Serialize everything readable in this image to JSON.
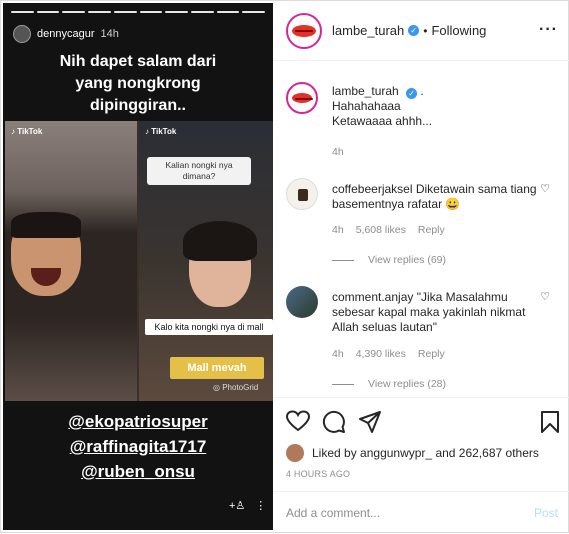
{
  "story": {
    "username": "dennycagur",
    "time": "14h",
    "caption_lines": [
      "Nih dapet salam dari",
      "yang nongkrong",
      "dipinggiran.."
    ],
    "tiktok_label": "TikTok",
    "bubble_question": "Kalian nongki nya dimana?",
    "bubble_answer": "Kalo kita nongki nya di mall",
    "mall_label": "Mall mevah",
    "photogrid_label": "PhotoGrid",
    "mentions": [
      "@ekopatriosuper",
      "@raffinagita1717",
      "@ruben_onsu"
    ]
  },
  "header": {
    "username": "lambe_turah",
    "following": "Following"
  },
  "caption": {
    "username": "lambe_turah",
    "text_line1": "Hahahahaaa",
    "text_line2": "Ketawaaaa ahhh...",
    "age": "4h"
  },
  "comments": [
    {
      "username": "coffebeerjaksel",
      "text": "Diketawain sama tiang basementnya rafatar 😀",
      "age": "4h",
      "likes": "5,608 likes",
      "reply": "Reply",
      "view_replies": "View replies (69)"
    },
    {
      "username": "comment.anjay",
      "text": "\"Jika Masalahmu sebesar kapal maka yakinlah nikmat Allah seluas lautan\"",
      "age": "4h",
      "likes": "4,390 likes",
      "reply": "Reply",
      "view_replies": "View replies (28)"
    }
  ],
  "likes": {
    "prefix": "Liked by",
    "user": "anggunwypr_",
    "suffix": "and 262,687 others"
  },
  "timestamp": "4 HOURS AGO",
  "add_comment": {
    "placeholder": "Add a comment...",
    "post_label": "Post"
  },
  "colors": {
    "link_blue": "#3897f0",
    "post_disabled": "#b2dffc",
    "muted": "#8e8e8e"
  }
}
